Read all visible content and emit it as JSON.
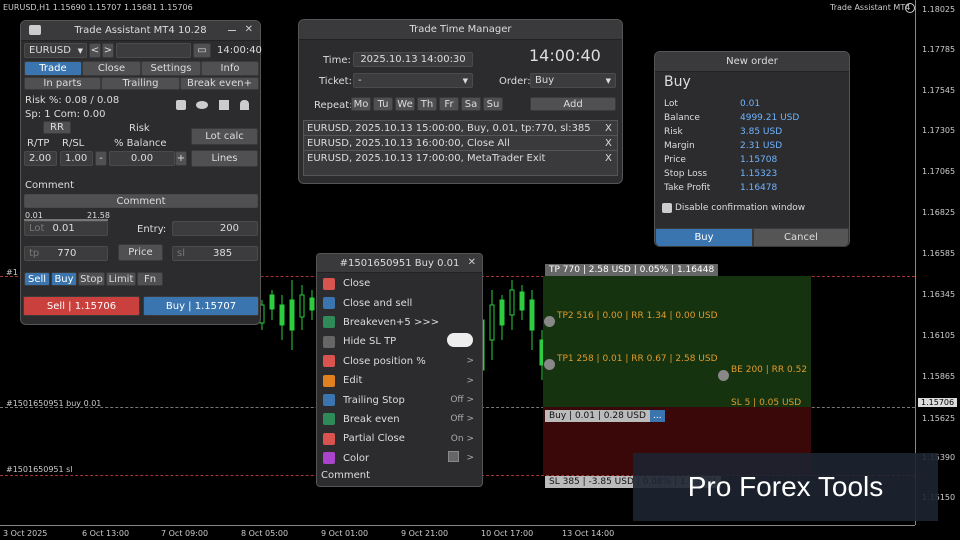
{
  "chart": {
    "symbol_label": "EURUSD,H1  1.15690 1.15707 1.15681 1.15706",
    "title_right": "Trade Assistant MT4",
    "y_ticks": [
      "1.18025",
      "1.17785",
      "1.17545",
      "1.17305",
      "1.17065",
      "1.16825",
      "1.16585",
      "1.16345",
      "1.16105",
      "1.15865",
      "1.15706",
      "1.15625",
      "1.15390",
      "1.15150"
    ],
    "x_ticks": [
      "3 Oct 2025",
      "6 Oct 13:00",
      "7 Oct 09:00",
      "8 Oct 05:00",
      "9 Oct 01:00",
      "9 Oct 21:00",
      "10 Oct 17:00",
      "13 Oct 14:00"
    ],
    "line_labels": {
      "tp": "#1",
      "buy": "#1501650951 buy 0.01",
      "sl": "#1501650951 sl"
    },
    "zone_labels": {
      "tp": "TP 770 | 2.58 USD | 0.05% | 1.16448",
      "tp2": "TP2 516 | 0.00 | RR 1.34 | 0.00 USD",
      "tp1": "TP1 258 | 0.01 | RR 0.67 | 2.58 USD",
      "be": "BE 200 | RR 0.52",
      "sl5": "SL 5 | 0.05 USD",
      "buy": "Buy | 0.01 | 0.28 USD",
      "buy_btn": "...",
      "sl": "SL 385 | -3.85 USD | 0.08% | 1.15321"
    },
    "watermark": "Pro Forex Tools"
  },
  "ta": {
    "title": "Trade Assistant MT4 10.28",
    "symbol": "EURUSD",
    "time": "14:00:40",
    "tabs": [
      "Trade",
      "Close",
      "Settings",
      "Info"
    ],
    "sub_tabs": [
      "In parts",
      "Trailing",
      "Break even+"
    ],
    "risk_line": "Risk %: 0.08 /  0.08",
    "sp_line": "Sp: 1  Com: 0.00",
    "rr_btn": "RR",
    "rtp": "R/TP",
    "rsl": "R/SL",
    "risk_lbl": "Risk",
    "balance_lbl": "% Balance",
    "lot_calc": "Lot calc",
    "rtp_val": "2.00",
    "rsl_val": "1.00",
    "minus": "-",
    "risk_val": "0.00",
    "plus": "+",
    "lines": "Lines",
    "comment_lbl": "Comment",
    "comment_val": "Comment",
    "min_lot": "0.01",
    "max_lot": "21.58",
    "lot_ph": "Lot",
    "lot_val": "0.01",
    "entry_lbl": "Entry:",
    "entry_val": "200",
    "tp_ph": "tp",
    "tp_val": "770",
    "price_btn": "Price",
    "sl_ph": "sl",
    "sl_val": "385",
    "order_types": [
      "Sell",
      "Buy",
      "Stop",
      "Limit",
      "Fn"
    ],
    "sell_btn": "Sell  | 1.15706",
    "buy_btn": "Buy  | 1.15707"
  },
  "ttm": {
    "title": "Trade Time Manager",
    "time_lbl": "Time:",
    "time_val": "2025.10.13 14:00:30",
    "clock": "14:00:40",
    "ticket_lbl": "Ticket:",
    "ticket_val": "-",
    "order_lbl": "Order:",
    "order_val": "Buy",
    "repeat_lbl": "Repeat:",
    "days": [
      "Mo",
      "Tu",
      "We",
      "Th",
      "Fr",
      "Sa",
      "Su"
    ],
    "add": "Add",
    "rows": [
      "EURUSD, 2025.10.13 15:00:00, Buy, 0.01, tp:770, sl:385",
      "EURUSD, 2025.10.13 16:00:00, Close All",
      "EURUSD, 2025.10.13 17:00:00, MetaTrader Exit"
    ],
    "x": "X"
  },
  "no": {
    "title": "New order",
    "heading": "Buy",
    "rows": [
      {
        "k": "Lot",
        "v": "0.01"
      },
      {
        "k": "Balance",
        "v": "4999.21 USD"
      },
      {
        "k": "Risk",
        "v": "3.85 USD"
      },
      {
        "k": "Margin",
        "v": "2.31 USD"
      },
      {
        "k": "Price",
        "v": "1.15708"
      },
      {
        "k": "Stop Loss",
        "v": "1.15323"
      },
      {
        "k": "Take Profit",
        "v": "1.16478"
      }
    ],
    "disable": "Disable confirmation window",
    "buy": "Buy",
    "cancel": "Cancel"
  },
  "menu": {
    "title": "#1501650951 Buy 0.01",
    "items": [
      {
        "label": "Close",
        "right": "",
        "color": "#d9534f",
        "icon": "close-icon"
      },
      {
        "label": "Close and sell",
        "right": "",
        "color": "#3a75b0",
        "icon": "swap-icon"
      },
      {
        "label": "Breakeven+5 >>>",
        "right": "",
        "color": "#2e8b57",
        "icon": "shield-icon"
      },
      {
        "label": "Hide SL TP",
        "right": "",
        "color": "#666",
        "icon": "cloud-icon"
      },
      {
        "label": "Close position %",
        "right": ">",
        "color": "#d9534f",
        "icon": "percent-icon"
      },
      {
        "label": "Edit",
        "right": ">",
        "color": "#e08020",
        "icon": "wrench-icon"
      },
      {
        "label": "Trailing Stop",
        "right": "Off  >",
        "color": "#3a75b0",
        "icon": "trail-icon"
      },
      {
        "label": "Break even",
        "right": "Off  >",
        "color": "#2e8b57",
        "icon": "shield-icon"
      },
      {
        "label": "Partial Close",
        "right": "On  >",
        "color": "#d9534f",
        "icon": "partial-icon"
      },
      {
        "label": "Color",
        "right": ">",
        "color": "#aa44cc",
        "icon": "palette-icon"
      }
    ],
    "comment": "Comment"
  }
}
